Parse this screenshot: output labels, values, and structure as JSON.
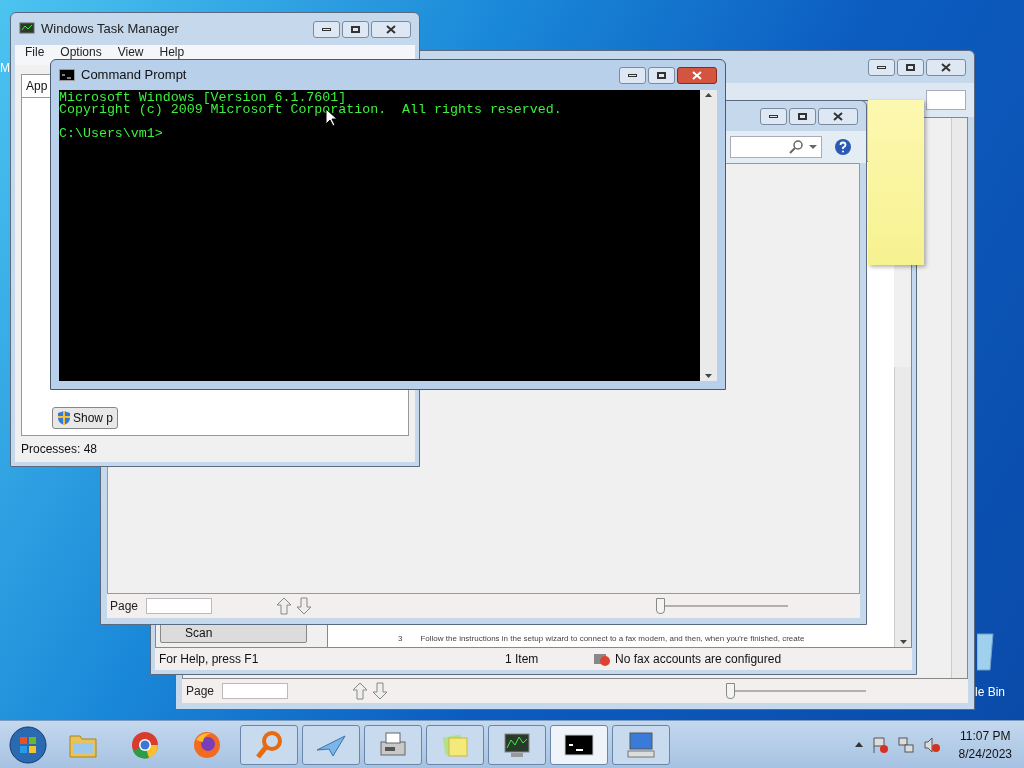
{
  "desktop": {
    "icons": [
      {
        "label": "M"
      },
      {
        "label": "le Bin"
      }
    ]
  },
  "back_window": {
    "page_label": "Page",
    "slider": {
      "level": 0
    }
  },
  "fax_window": {
    "scan_button": "Scan",
    "instruction_number": "3",
    "instruction": "Follow the instructions in the setup wizard to connect to a fax modem, and then, when you're finished, create",
    "status_bar": [
      "For Help, press F1",
      "1 Item",
      "No fax accounts are configured"
    ]
  },
  "viewer_window": {
    "page_label": "Page",
    "slider": {
      "level": 0
    }
  },
  "task_manager": {
    "title": "Windows Task Manager",
    "menu": [
      "File",
      "Options",
      "View",
      "Help"
    ],
    "tab": "App",
    "button": "Show p",
    "status": "Processes: 48"
  },
  "command_prompt": {
    "title": "Command Prompt",
    "banner": [
      "Microsoft Windows [Version 6.1.7601]",
      "Copyright (c) 2009 Microsoft Corporation.  All rights reserved."
    ],
    "prompt": "C:\\Users\\vm1>"
  },
  "taskbar": {
    "items": [
      {
        "kind": "folder",
        "running": false,
        "selected": false
      },
      {
        "kind": "chrome",
        "running": false,
        "selected": false
      },
      {
        "kind": "firefox",
        "running": false,
        "selected": false
      },
      {
        "kind": "magnifier",
        "running": true,
        "selected": false
      },
      {
        "kind": "plane",
        "running": true,
        "selected": false
      },
      {
        "kind": "fax",
        "running": true,
        "selected": false
      },
      {
        "kind": "notes",
        "running": true,
        "selected": false
      },
      {
        "kind": "taskmgr",
        "running": true,
        "selected": false
      },
      {
        "kind": "cmd",
        "running": true,
        "selected": true
      },
      {
        "kind": "remote",
        "running": true,
        "selected": false
      }
    ],
    "tray": {
      "time": "11:07 PM",
      "date": "8/24/2023"
    }
  }
}
